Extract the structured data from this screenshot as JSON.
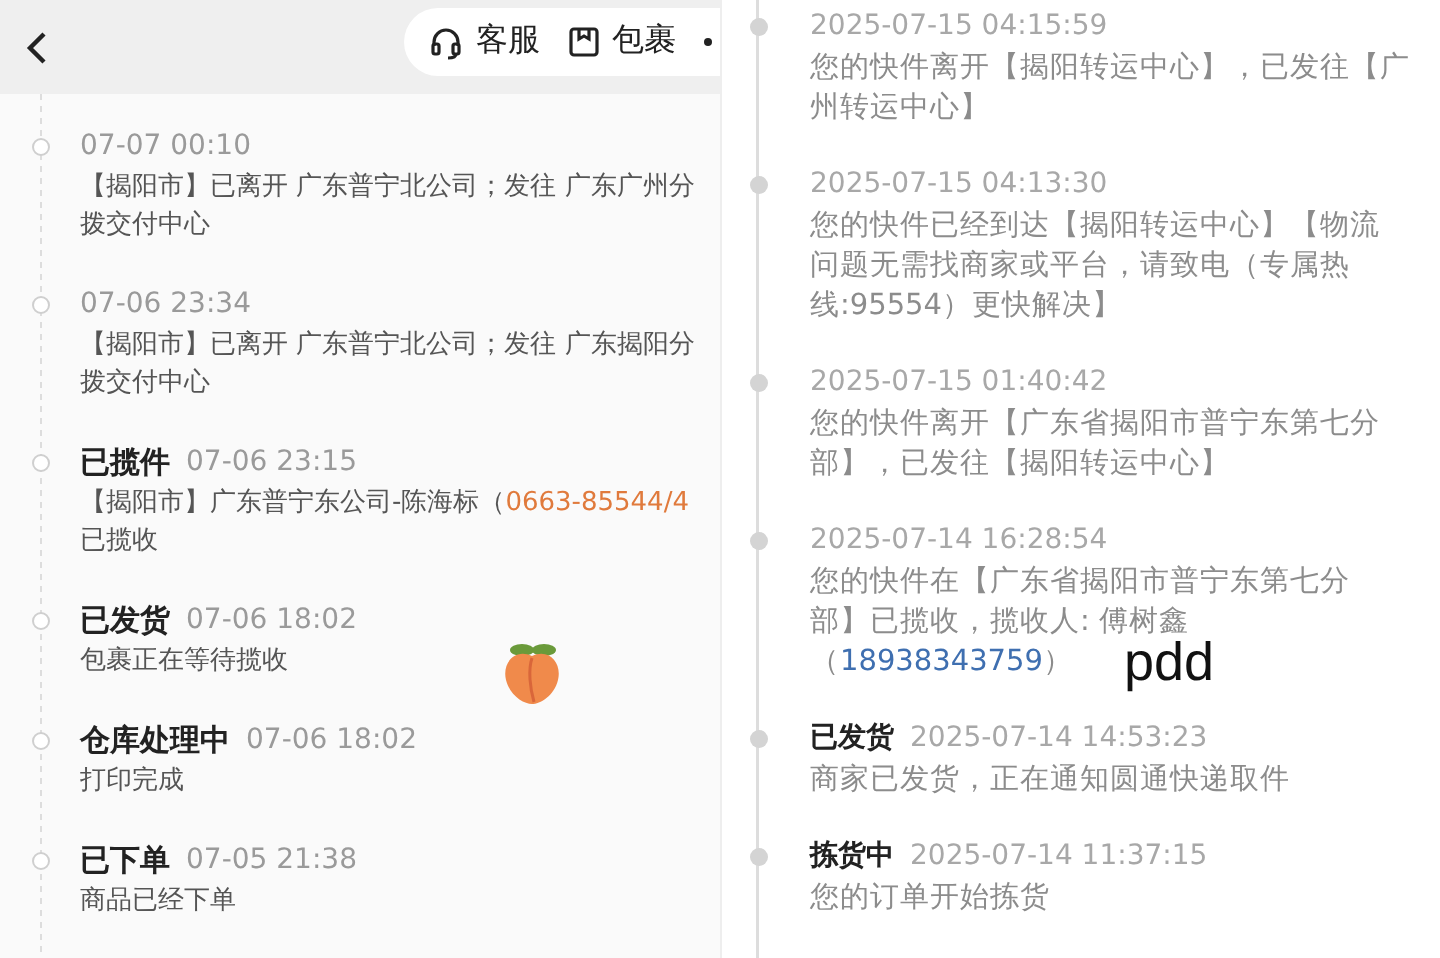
{
  "left": {
    "header": {
      "actions": [
        {
          "kind": "headset",
          "label": "客服"
        },
        {
          "kind": "package",
          "label": "包裹"
        }
      ]
    },
    "events": [
      {
        "time": "07-07 00:10",
        "lines": [
          {
            "text": "【揭阳市】已离开 广东普宁北公司；发往 广东广州分"
          },
          {
            "text": "拨交付中心"
          }
        ]
      },
      {
        "time": "07-06 23:34",
        "lines": [
          {
            "text": "【揭阳市】已离开 广东普宁北公司；发往 广东揭阳分"
          },
          {
            "text": "拨交付中心"
          }
        ]
      },
      {
        "status": "已揽件",
        "time": "07-06 23:15",
        "lines": [
          {
            "text": "【揭阳市】广东普宁东公司-陈海标（",
            "phone": "0663-85544/4"
          },
          {
            "text": "已揽收"
          }
        ]
      },
      {
        "status": "已发货",
        "time": "07-06 18:02",
        "lines": [
          {
            "text": "包裹正在等待揽收"
          }
        ]
      },
      {
        "status": "仓库处理中",
        "time": "07-06 18:02",
        "lines": [
          {
            "text": "打印完成"
          }
        ]
      },
      {
        "status": "已下单",
        "time": "07-05 21:38",
        "lines": [
          {
            "text": "商品已经下单"
          }
        ]
      }
    ]
  },
  "right": {
    "events": [
      {
        "time": "2025-07-15 04:15:59",
        "lines": [
          {
            "text": "您的快件离开【揭阳转运中心】，已发往【广"
          },
          {
            "text": "州转运中心】"
          }
        ]
      },
      {
        "time": "2025-07-15 04:13:30",
        "lines": [
          {
            "text": "您的快件已经到达【揭阳转运中心】【物流"
          },
          {
            "text": "问题无需找商家或平台，请致电（专属热"
          },
          {
            "text": "线:95554）更快解决】"
          }
        ]
      },
      {
        "time": "2025-07-15 01:40:42",
        "lines": [
          {
            "text": "您的快件离开【广东省揭阳市普宁东第七分"
          },
          {
            "text": "部】，已发往【揭阳转运中心】"
          }
        ]
      },
      {
        "time": "2025-07-14 16:28:54",
        "lines": [
          {
            "text": "您的快件在【广东省揭阳市普宁东第七分"
          },
          {
            "text": "部】已揽收，揽收人: 傅树鑫"
          },
          {
            "text": "（",
            "phone": "18938343759",
            "after": "）"
          }
        ]
      },
      {
        "status": "已发货",
        "time": "2025-07-14 14:53:23",
        "lines": [
          {
            "text": "商家已发货，正在通知圆通快递取件"
          }
        ]
      },
      {
        "status": "拣货中",
        "time": "2025-07-14 11:37:15",
        "lines": [
          {
            "text": "您的订单开始拣货"
          }
        ]
      }
    ]
  },
  "annotation": {
    "text": "pdd"
  }
}
